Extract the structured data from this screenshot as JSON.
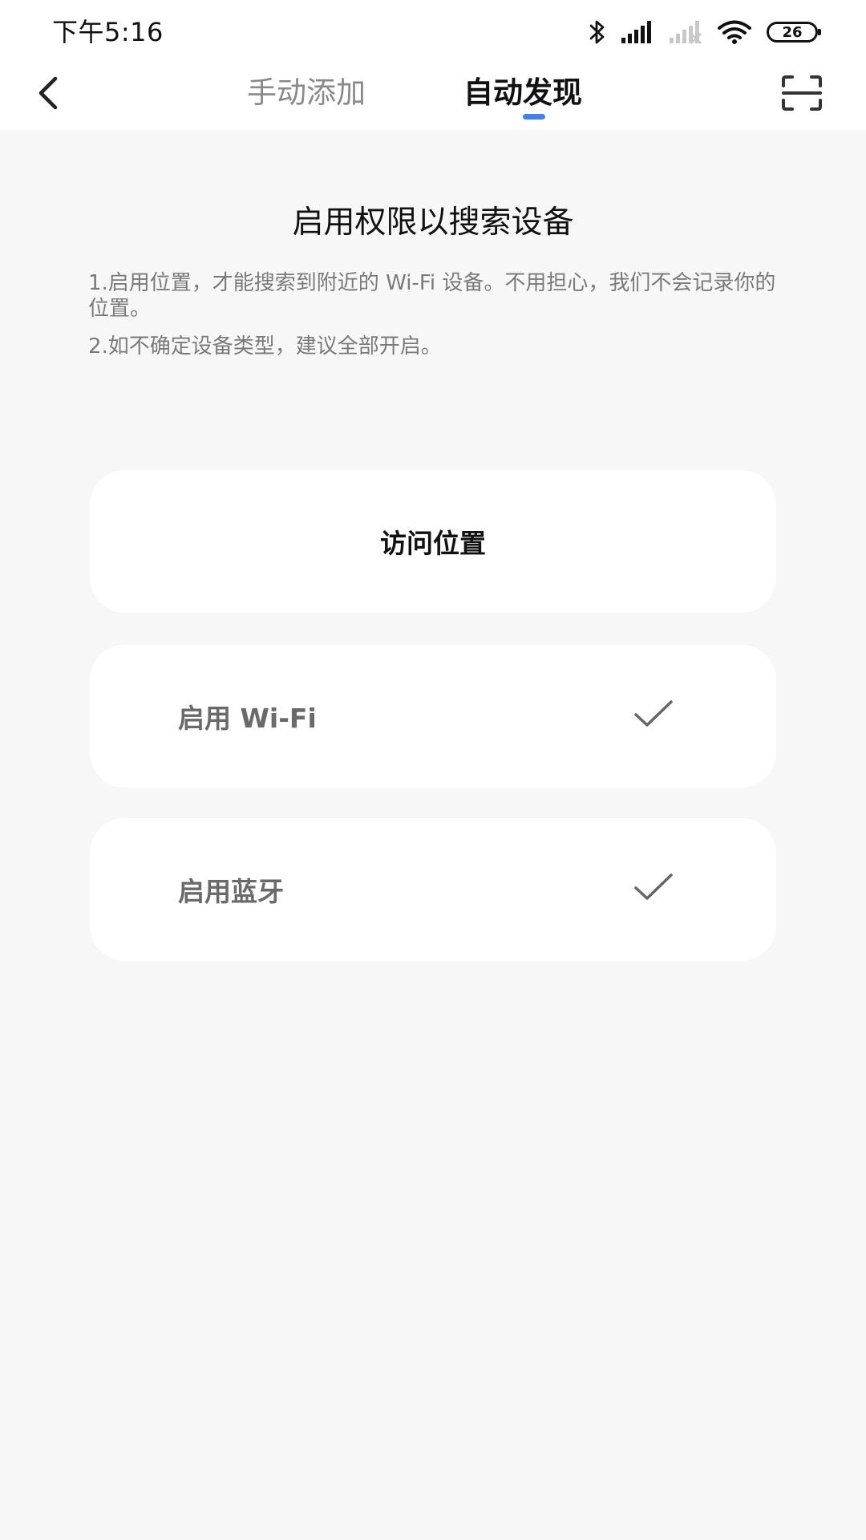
{
  "status_bar": {
    "time": "下午5:16",
    "battery": "26",
    "icons": [
      "bluetooth-icon",
      "signal-icon",
      "signal-disabled-icon",
      "wifi-icon",
      "battery-icon"
    ]
  },
  "header": {
    "back_icon": "chevron-left-icon",
    "tabs": [
      {
        "label": "手动添加",
        "active": false
      },
      {
        "label": "自动发现",
        "active": true
      }
    ],
    "scan_icon": "scan-icon",
    "accent_color": "#4a7ee6"
  },
  "main": {
    "title": "启用权限以搜索设备",
    "tips": [
      "1.启用位置，才能搜索到附近的 Wi-Fi 设备。不用担心，我们不会记录你的位置。",
      "2.如不确定设备类型，建议全部开启。"
    ],
    "permissions": [
      {
        "label": "访问位置",
        "enabled": false
      },
      {
        "label": "启用 Wi-Fi",
        "enabled": true,
        "icon": "check-icon"
      },
      {
        "label": "启用蓝牙",
        "enabled": true,
        "icon": "check-icon"
      }
    ]
  }
}
